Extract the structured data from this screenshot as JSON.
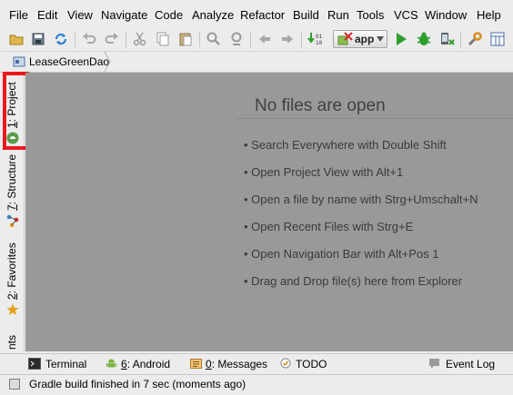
{
  "menu": [
    "File",
    "Edit",
    "View",
    "Navigate",
    "Code",
    "Analyze",
    "Refactor",
    "Build",
    "Run",
    "Tools",
    "VCS",
    "Window",
    "Help"
  ],
  "toolbar": {
    "run_config": "app",
    "icons": [
      "open-folder-icon",
      "save-icon",
      "sync-icon",
      "undo-icon",
      "redo-icon",
      "cut-icon",
      "copy-icon",
      "paste-icon",
      "find-icon",
      "replace-icon",
      "back-icon",
      "forward-icon",
      "make-project-icon",
      "run-config-icon",
      "run-icon",
      "debug-icon",
      "attach-debugger-icon",
      "settings-icon",
      "project-structure-icon"
    ]
  },
  "breadcrumb": {
    "project": "LeaseGreenDao"
  },
  "left_tabs": {
    "project": {
      "num": "1",
      "label": ": Project"
    },
    "structure": {
      "num": "7",
      "label": ": Structure"
    },
    "favorites": {
      "num": "2",
      "label": ": Favorites"
    },
    "build_variants_fragment": "nts"
  },
  "editor": {
    "title": "No files are open",
    "hints": [
      "Search Everywhere with Double Shift",
      "Open Project View with Alt+1",
      "Open a file by name with Strg+Umschalt+N",
      "Open Recent Files with Strg+E",
      "Open Navigation Bar with Alt+Pos 1",
      "Drag and Drop file(s) here from Explorer"
    ]
  },
  "bottom_tabs": {
    "terminal": "Terminal",
    "android_num": "6",
    "android": ": Android",
    "messages_num": "0",
    "messages": ": Messages",
    "todo": "TODO",
    "event_log": "Event Log"
  },
  "status": {
    "text": "Gradle build finished in 7 sec (moments ago)"
  },
  "colors": {
    "highlight": "#e8191d",
    "editor_bg": "#999999",
    "run_green": "#2f9e2f"
  }
}
